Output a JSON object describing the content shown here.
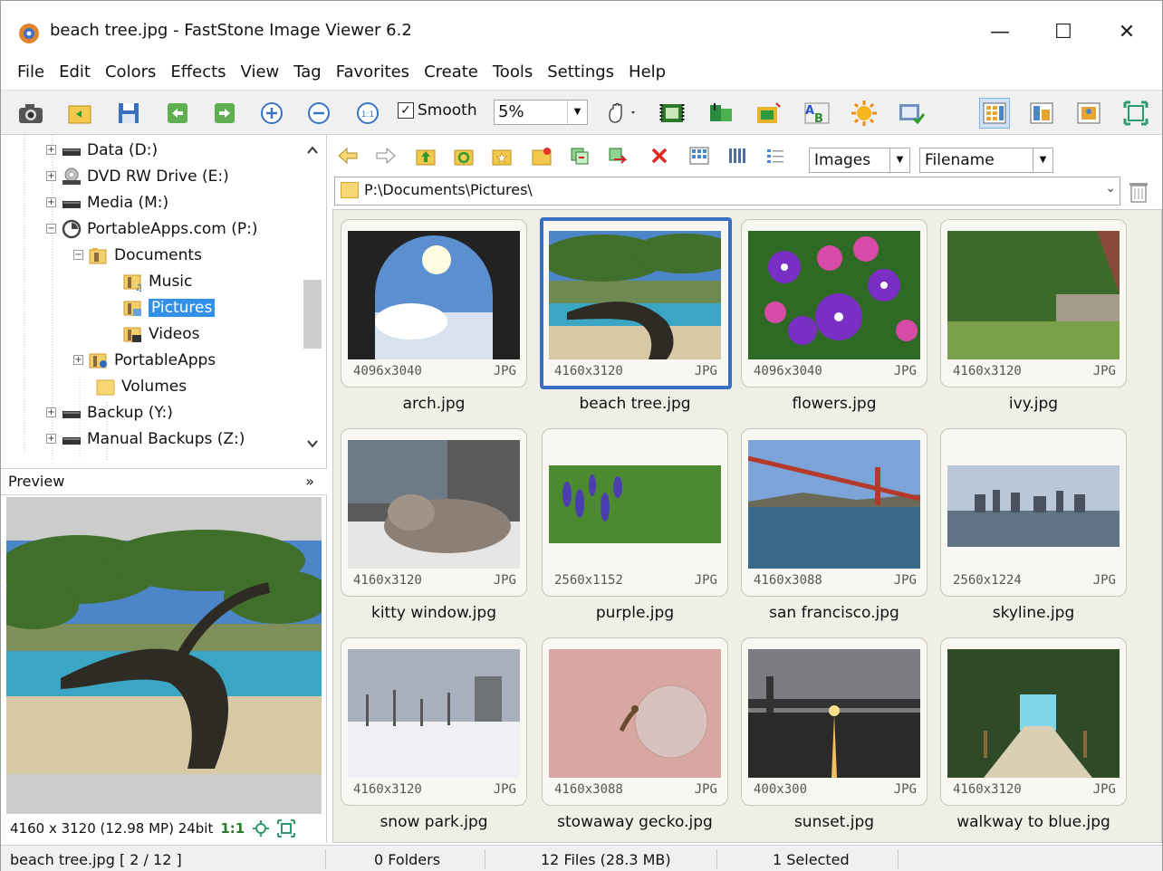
{
  "window": {
    "title": "beach tree.jpg  -  FastStone Image Viewer 6.2",
    "minimize": "—",
    "maximize": "☐",
    "close": "✕"
  },
  "menu": [
    "File",
    "Edit",
    "Colors",
    "Effects",
    "View",
    "Tag",
    "Favorites",
    "Create",
    "Tools",
    "Settings",
    "Help"
  ],
  "toolbar": {
    "smooth_label": "Smooth",
    "smooth_checked": "✓",
    "zoom_value": "5%"
  },
  "tree": {
    "items": [
      {
        "label": "Data (D:)"
      },
      {
        "label": "DVD RW Drive (E:)"
      },
      {
        "label": "Media (M:)"
      },
      {
        "label": "PortableApps.com (P:)"
      },
      {
        "label": "Documents"
      },
      {
        "label": "Music"
      },
      {
        "label": "Pictures"
      },
      {
        "label": "Videos"
      },
      {
        "label": "PortableApps"
      },
      {
        "label": "Volumes"
      },
      {
        "label": "Backup (Y:)"
      },
      {
        "label": "Manual Backups (Z:)"
      }
    ]
  },
  "preview": {
    "header": "Preview",
    "collapse": "»",
    "info": "4160 x 3120 (12.98 MP)  24bit",
    "ratio": "1:1"
  },
  "browser": {
    "filter": "Images",
    "sort": "Filename",
    "path": "P:\\Documents\\Pictures\\"
  },
  "thumbnails": [
    {
      "name": "arch.jpg",
      "dims": "4096x3040",
      "fmt": "JPG"
    },
    {
      "name": "beach tree.jpg",
      "dims": "4160x3120",
      "fmt": "JPG"
    },
    {
      "name": "flowers.jpg",
      "dims": "4096x3040",
      "fmt": "JPG"
    },
    {
      "name": "ivy.jpg",
      "dims": "4160x3120",
      "fmt": "JPG"
    },
    {
      "name": "kitty window.jpg",
      "dims": "4160x3120",
      "fmt": "JPG"
    },
    {
      "name": "purple.jpg",
      "dims": "2560x1152",
      "fmt": "JPG"
    },
    {
      "name": "san francisco.jpg",
      "dims": "4160x3088",
      "fmt": "JPG"
    },
    {
      "name": "skyline.jpg",
      "dims": "2560x1224",
      "fmt": "JPG"
    },
    {
      "name": "snow park.jpg",
      "dims": "4160x3120",
      "fmt": "JPG"
    },
    {
      "name": "stowaway gecko.jpg",
      "dims": "4160x3088",
      "fmt": "JPG"
    },
    {
      "name": "sunset.jpg",
      "dims": "400x300",
      "fmt": "JPG"
    },
    {
      "name": "walkway to blue.jpg",
      "dims": "4160x3120",
      "fmt": "JPG"
    }
  ],
  "status": {
    "file": "beach tree.jpg [ 2 / 12 ]",
    "folders": "0 Folders",
    "files": "12 Files (28.3 MB)",
    "selected": "1 Selected"
  },
  "colors": {
    "selection": "#3390e8",
    "thumb_selected_border": "#3870c4",
    "thumb_area_bg": "#f0efe6"
  }
}
